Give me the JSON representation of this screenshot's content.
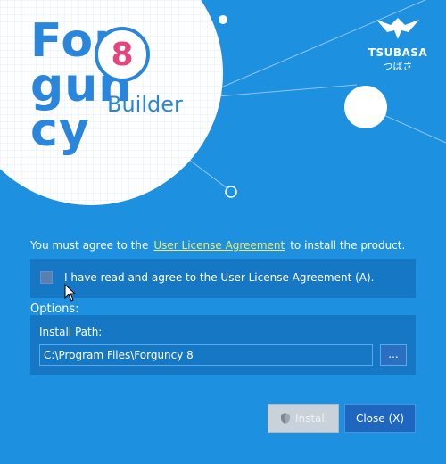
{
  "product": {
    "logo_line1": "For",
    "logo_line2": "gun",
    "logo_line3": "cy",
    "version": "8",
    "edition": "Builder"
  },
  "brand": {
    "name": "TSUBASA",
    "kana": "つばさ"
  },
  "license": {
    "prefix": "You must agree to the",
    "link": "User License Agreement",
    "suffix": "to install the product.",
    "checkbox_label": "I have read and agree to the User License Agreement (A).",
    "checked": false
  },
  "options": {
    "heading": "Options:",
    "install_path_label": "Install Path:",
    "install_path_value": "C:\\Program Files\\Forguncy 8",
    "browse_label": "..."
  },
  "buttons": {
    "install": "Install",
    "close": "Close (X)"
  },
  "colors": {
    "background": "#1e90e0",
    "panel": "#1677c4",
    "link": "#f4e86a",
    "logo_blue": "#2a86dc",
    "version_pink": "#e8437a"
  },
  "icons": {
    "install_shield": "shield-icon",
    "cursor": "mouse-cursor-icon",
    "brand_mark": "tsubasa-bird-icon"
  }
}
